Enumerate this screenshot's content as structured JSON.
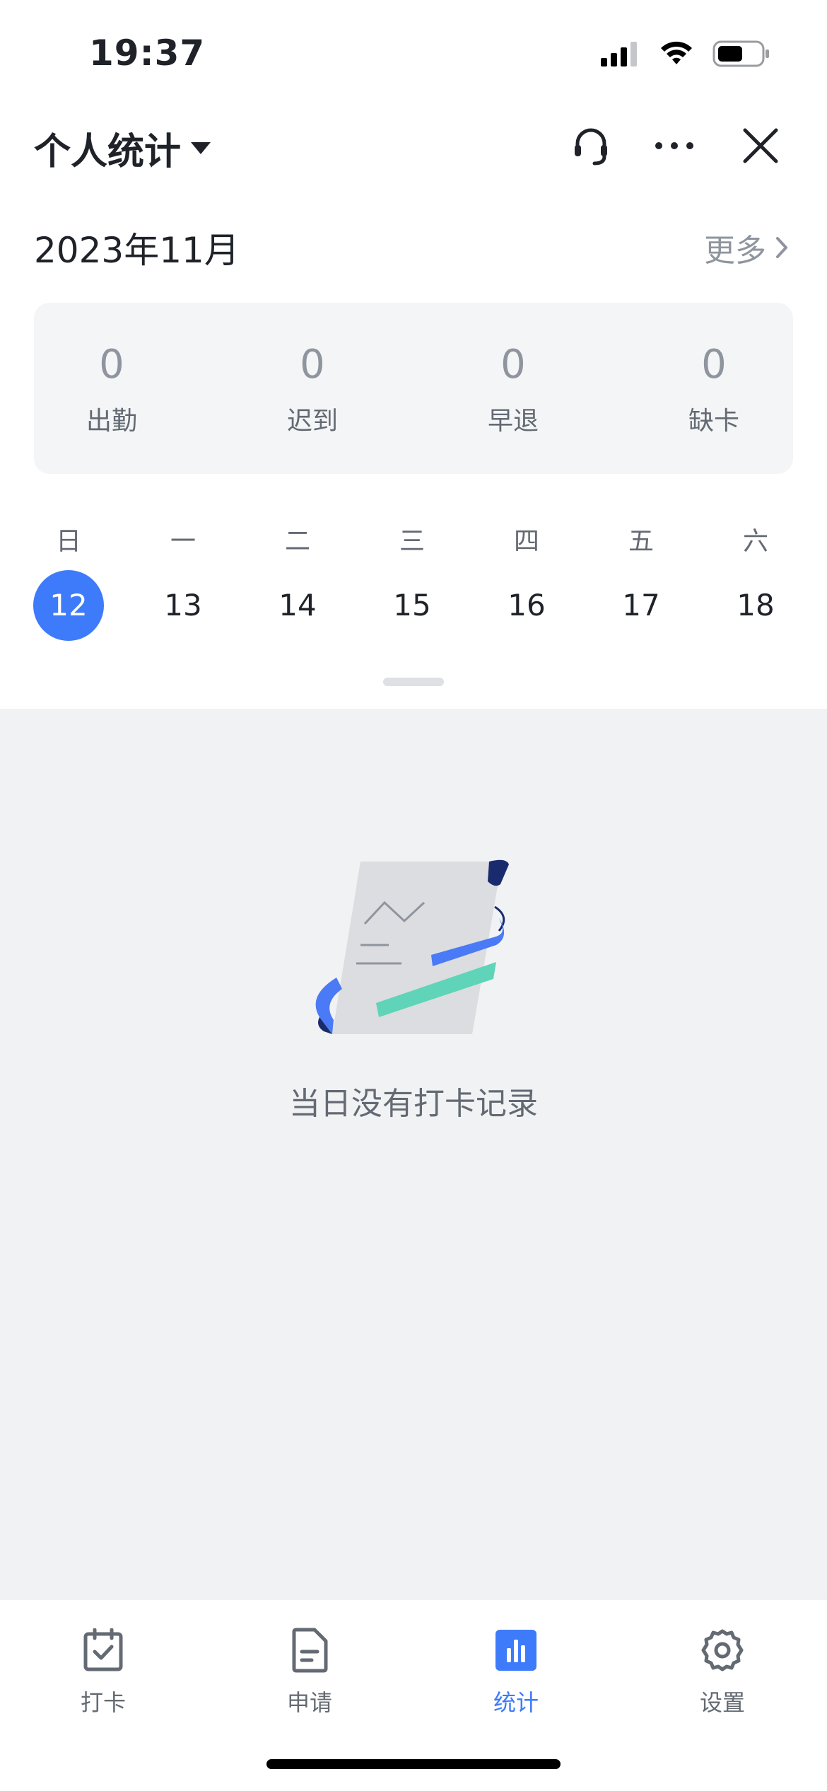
{
  "status_bar": {
    "time": "19:37"
  },
  "header": {
    "title": "个人统计"
  },
  "month": {
    "label": "2023年11月",
    "more": "更多"
  },
  "summary": [
    {
      "value": "0",
      "label": "出勤"
    },
    {
      "value": "0",
      "label": "迟到"
    },
    {
      "value": "0",
      "label": "早退"
    },
    {
      "value": "0",
      "label": "缺卡"
    }
  ],
  "week": {
    "days": [
      "日",
      "一",
      "二",
      "三",
      "四",
      "五",
      "六"
    ],
    "dates": [
      "12",
      "13",
      "14",
      "15",
      "16",
      "17",
      "18"
    ],
    "selected_index": 0
  },
  "empty": {
    "text": "当日没有打卡记录"
  },
  "tabs": [
    {
      "label": "打卡",
      "icon": "calendar-check-icon"
    },
    {
      "label": "申请",
      "icon": "document-icon"
    },
    {
      "label": "统计",
      "icon": "bar-chart-icon"
    },
    {
      "label": "设置",
      "icon": "gear-icon"
    }
  ],
  "active_tab": 2,
  "colors": {
    "accent": "#3e7bfa",
    "illustration_teal": "#5fd4b8",
    "illustration_navy": "#1a2b6d"
  }
}
